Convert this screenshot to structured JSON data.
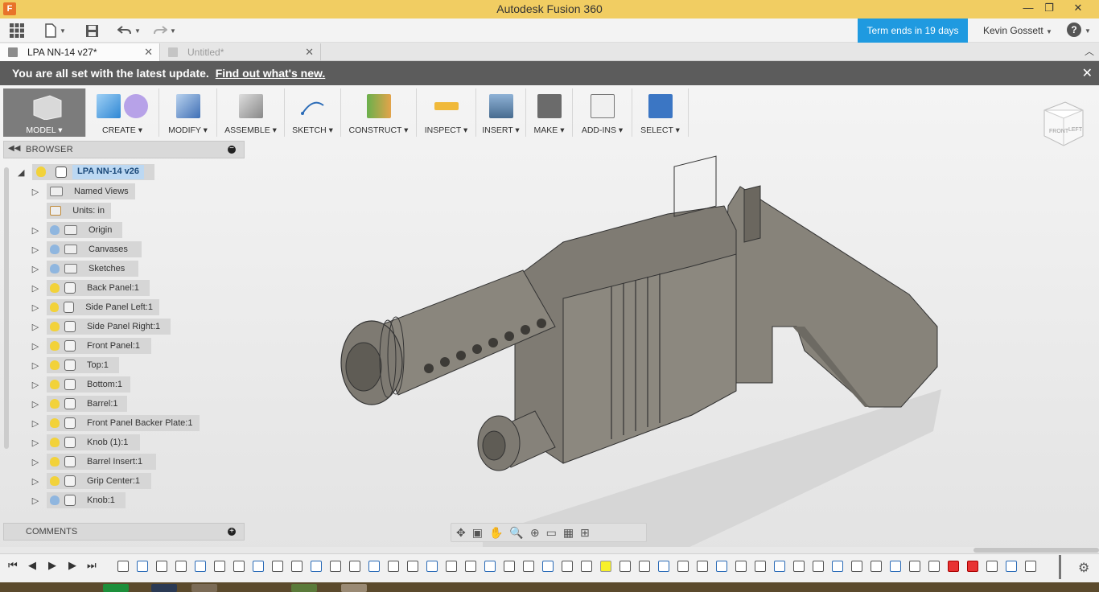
{
  "window": {
    "title": "Autodesk Fusion 360",
    "controls": {
      "minimize": "—",
      "restore": "❐",
      "close": "✕"
    }
  },
  "menubar": {
    "term_banner": "Term ends in 19 days",
    "user": "Kevin Gossett",
    "help": "?"
  },
  "tabs": [
    {
      "label": "LPA NN-14 v27*",
      "active": true
    },
    {
      "label": "Untitled*",
      "active": false
    }
  ],
  "notice": {
    "message": "You are all set with the latest update.",
    "link": "Find out what's new."
  },
  "toolbar": {
    "groups": [
      {
        "label": "MODEL ▾"
      },
      {
        "label": "CREATE ▾"
      },
      {
        "label": "MODIFY ▾"
      },
      {
        "label": "ASSEMBLE ▾"
      },
      {
        "label": "SKETCH ▾"
      },
      {
        "label": "CONSTRUCT ▾"
      },
      {
        "label": "INSPECT ▾"
      },
      {
        "label": "INSERT ▾"
      },
      {
        "label": "MAKE ▾"
      },
      {
        "label": "ADD-INS ▾"
      },
      {
        "label": "SELECT ▾"
      }
    ]
  },
  "browser": {
    "title": "BROWSER",
    "root": "LPA NN-14 v26",
    "items": [
      {
        "label": "Named Views",
        "kind": "folder",
        "bulb": "none",
        "expandable": true
      },
      {
        "label": "Units: in",
        "kind": "units",
        "bulb": "none",
        "expandable": false
      },
      {
        "label": "Origin",
        "kind": "folder",
        "bulb": "blue",
        "expandable": true
      },
      {
        "label": "Canvases",
        "kind": "folder",
        "bulb": "blue",
        "expandable": true
      },
      {
        "label": "Sketches",
        "kind": "folder",
        "bulb": "blue",
        "expandable": true
      },
      {
        "label": "Back Panel:1",
        "kind": "component",
        "bulb": "yellow",
        "expandable": true
      },
      {
        "label": "Side Panel Left:1",
        "kind": "component",
        "bulb": "yellow",
        "expandable": true
      },
      {
        "label": "Side Panel Right:1",
        "kind": "component",
        "bulb": "yellow",
        "expandable": true
      },
      {
        "label": "Front Panel:1",
        "kind": "component",
        "bulb": "yellow",
        "expandable": true
      },
      {
        "label": "Top:1",
        "kind": "component",
        "bulb": "yellow",
        "expandable": true
      },
      {
        "label": "Bottom:1",
        "kind": "component",
        "bulb": "yellow",
        "expandable": true
      },
      {
        "label": "Barrel:1",
        "kind": "component",
        "bulb": "yellow",
        "expandable": true
      },
      {
        "label": "Front Panel Backer Plate:1",
        "kind": "component",
        "bulb": "yellow",
        "expandable": true
      },
      {
        "label": "Knob (1):1",
        "kind": "component",
        "bulb": "yellow",
        "expandable": true
      },
      {
        "label": "Barrel Insert:1",
        "kind": "component",
        "bulb": "yellow",
        "expandable": true
      },
      {
        "label": "Grip Center:1",
        "kind": "component",
        "bulb": "yellow",
        "expandable": true
      },
      {
        "label": "Knob:1",
        "kind": "component",
        "bulb": "blue",
        "expandable": true
      }
    ]
  },
  "comments": {
    "title": "COMMENTS"
  },
  "viewcube": {
    "front": "FRONT",
    "left": "LEFT"
  },
  "colors": {
    "titlebar": "#f1cd62",
    "term_banner": "#1f9ae0",
    "notice": "#5c5c5c",
    "model_body": "#7a776f",
    "bulb_yellow": "#f2d23a",
    "bulb_blue": "#8fb6df"
  }
}
